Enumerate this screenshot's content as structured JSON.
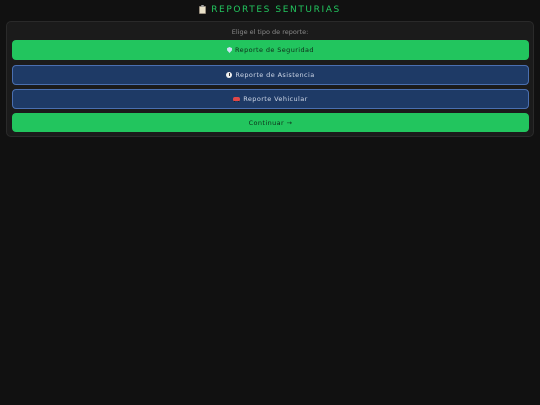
{
  "header": {
    "title": "REPORTES SENTURIAS",
    "icon": "clipboard-icon"
  },
  "card": {
    "prompt": "Elige el tipo de reporte:",
    "buttons": [
      {
        "label": "Reporte de Seguridad",
        "icon": "shield-icon",
        "state": "selected"
      },
      {
        "label": "Reporte de Asistencia",
        "icon": "clock-icon",
        "state": "default"
      },
      {
        "label": "Reporte Vehicular",
        "icon": "car-icon",
        "state": "default"
      }
    ],
    "continue_label": "Continuar →"
  },
  "colors": {
    "background": "#111111",
    "card": "#1b1b1b",
    "accent_green": "#22c55e",
    "button_blue": "#1e3a66",
    "button_blue_border": "#4a6fb0"
  }
}
